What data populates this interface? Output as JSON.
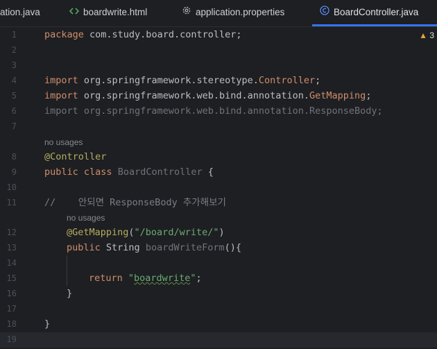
{
  "tabs": [
    {
      "label": "ation.java",
      "icon": "java-file-icon"
    },
    {
      "label": "boardwrite.html",
      "icon": "html-file-icon"
    },
    {
      "label": "application.properties",
      "icon": "gear-icon"
    },
    {
      "label": "BoardController.java",
      "icon": "class-icon",
      "active": true
    }
  ],
  "warnings": {
    "count": "3"
  },
  "line_numbers": [
    "1",
    "2",
    "3",
    "4",
    "5",
    "6",
    "7",
    "8",
    "9",
    "10",
    "11",
    "12",
    "13",
    "14",
    "15",
    "16",
    "17",
    "18",
    "19"
  ],
  "hints": {
    "no_usages_class": "no usages",
    "no_usages_method": "no usages"
  },
  "code": {
    "l1_kw": "package",
    "l1_rest": " com.study.board.controller;",
    "l4_kw": "import",
    "l4_pkg": " org.springframework.stereotype.",
    "l4_cls": "Controller",
    "l4_end": ";",
    "l5_kw": "import",
    "l5_pkg": " org.springframework.web.bind.annotation.",
    "l5_cls": "GetMapping",
    "l5_end": ";",
    "l6": "import org.springframework.web.bind.annotation.ResponseBody;",
    "l8": "@Controller",
    "l9_kw1": "public",
    "l9_kw2": " class",
    "l9_name": " BoardController",
    "l9_end": " {",
    "l11_slash": "//",
    "l11_text": "    안되면 ResponseBody 추가해보기",
    "l12_ann": "@GetMapping",
    "l12_open": "(",
    "l12_str": "\"/board/write/\"",
    "l12_close": ")",
    "l13_kw": "public",
    "l13_ty": " String",
    "l13_fn": " boardWriteForm",
    "l13_end": "(){",
    "l15_kw": "return",
    "l15_q1": " \"",
    "l15_str": "boardwrite",
    "l15_q2": "\"",
    "l15_end": ";",
    "l16": "}",
    "l18": "}"
  }
}
